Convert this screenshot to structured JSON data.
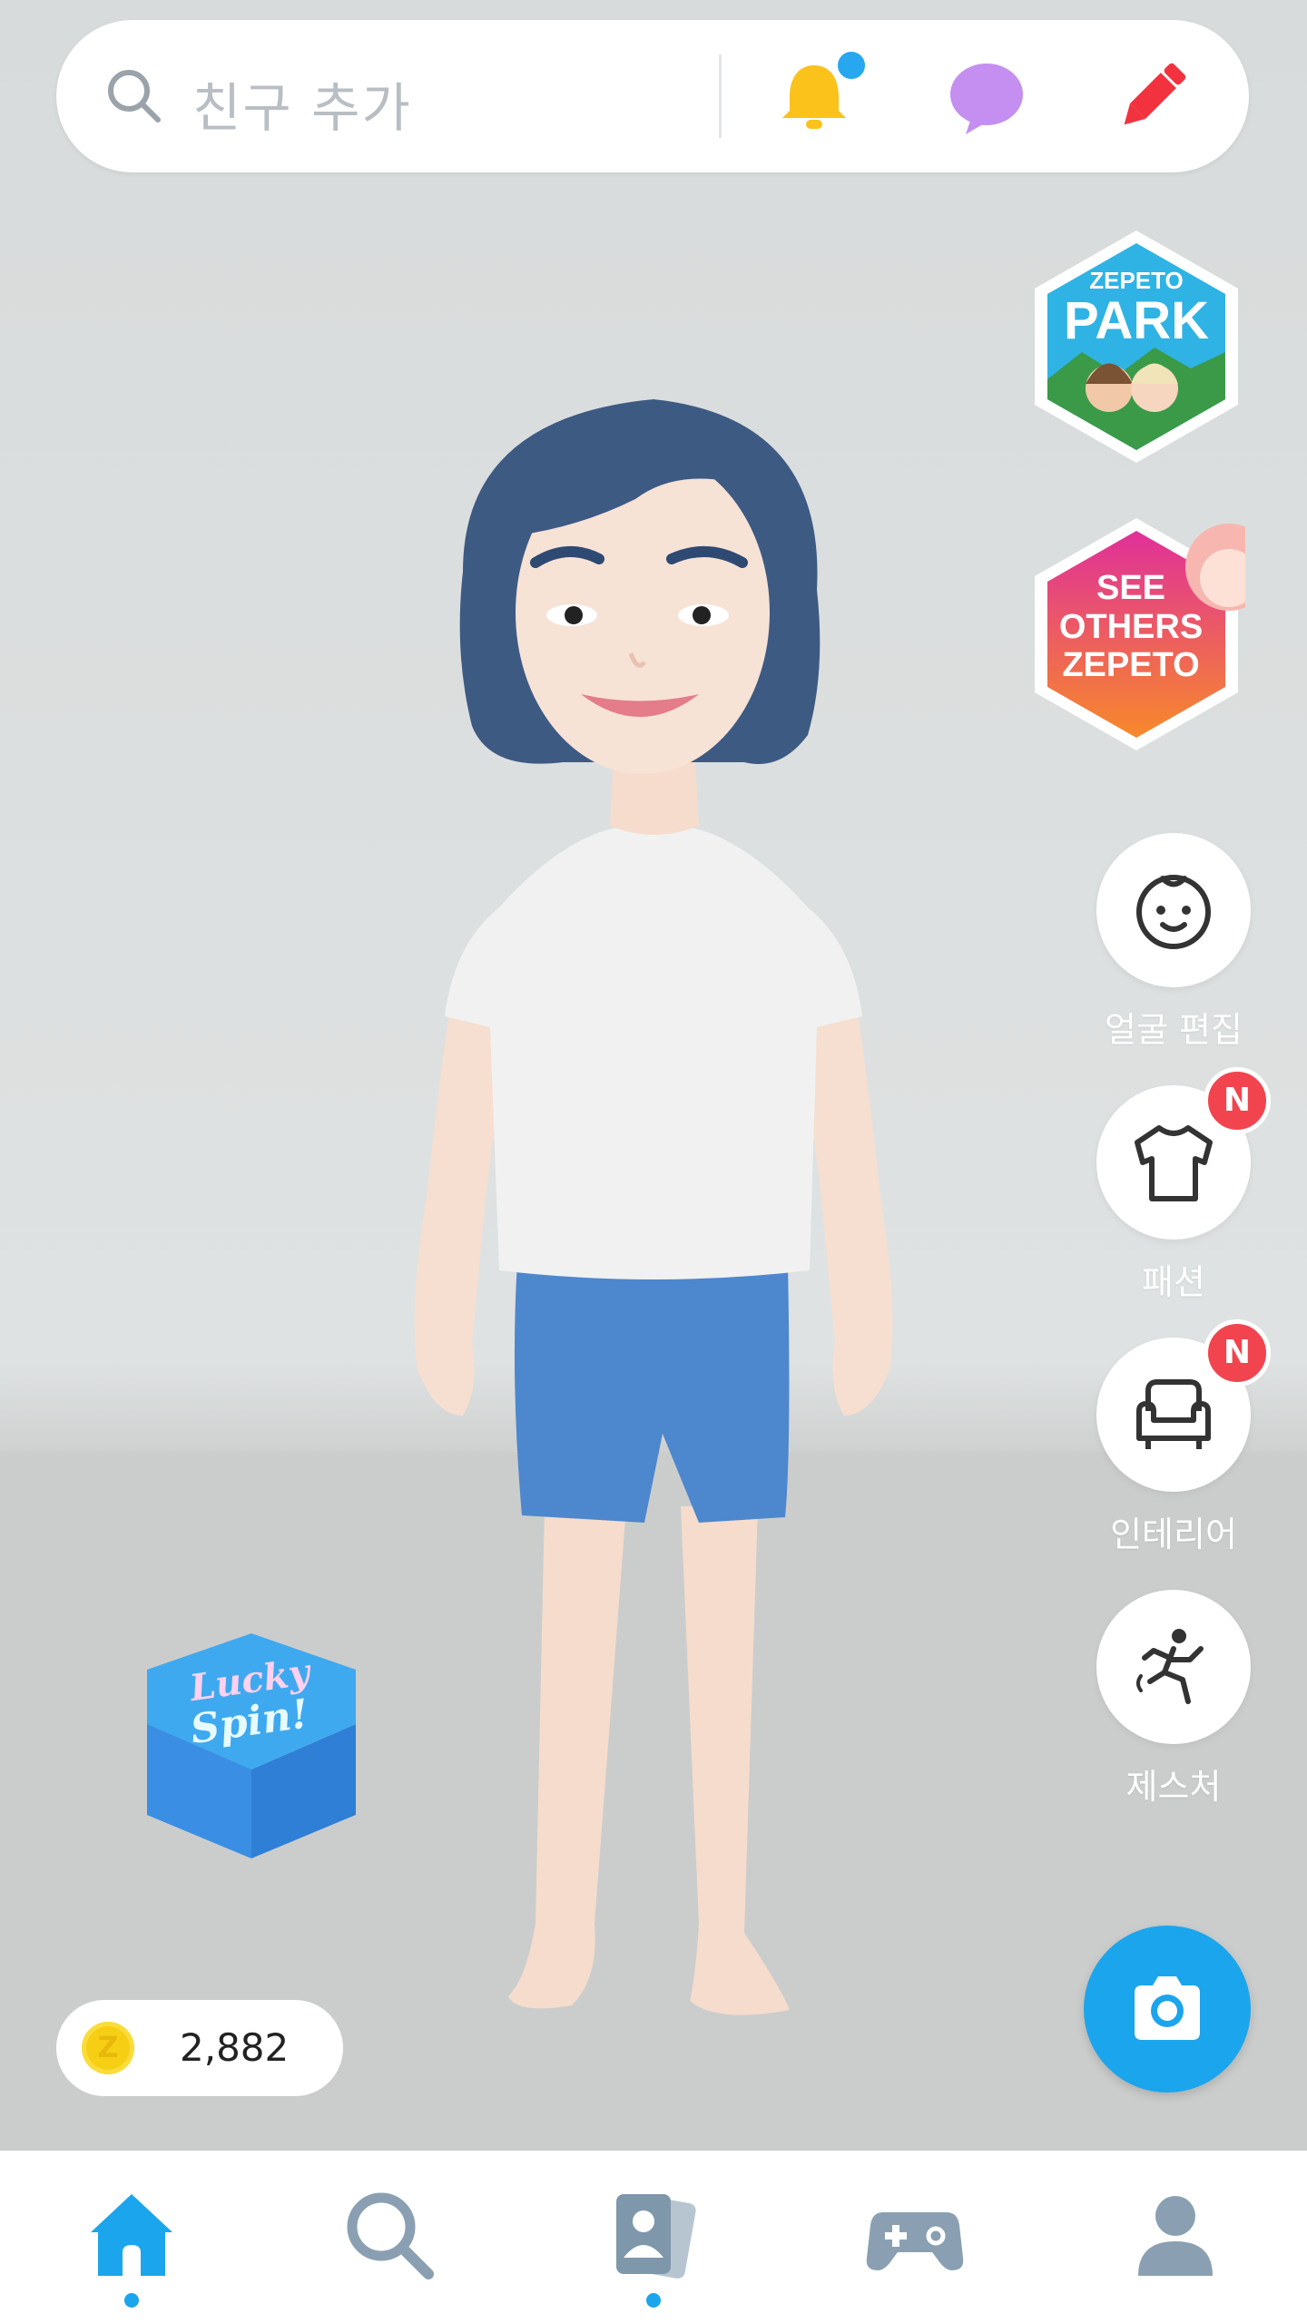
{
  "search": {
    "placeholder": "친구 추가"
  },
  "header_icons": [
    "search-icon",
    "bell-icon",
    "chat-icon",
    "pencil-icon"
  ],
  "banners": {
    "park": {
      "brand": "ZEPETO",
      "title": "PARK"
    },
    "see_others": {
      "line1": "SEE",
      "line2": "OTHERS",
      "line3": "ZEPETO"
    }
  },
  "side_menu": [
    {
      "label": "얼굴 편집",
      "icon": "face-icon",
      "badge": ""
    },
    {
      "label": "패션",
      "icon": "shirt-icon",
      "badge": "N"
    },
    {
      "label": "인테리어",
      "icon": "sofa-icon",
      "badge": "N"
    },
    {
      "label": "제스처",
      "icon": "gesture-icon",
      "badge": ""
    }
  ],
  "lucky_spin": {
    "line1": "Lucky",
    "line2": "Spin!"
  },
  "coins": {
    "icon_letter": "Z",
    "amount": "2,882"
  },
  "bottom_nav": [
    "home-icon",
    "search-icon",
    "feed-icon",
    "game-icon",
    "profile-icon"
  ],
  "colors": {
    "accent": "#1ba5ec",
    "bell": "#fbc21b",
    "chat": "#c48ff0",
    "pencil": "#f3323f",
    "badge": "#f1444f"
  }
}
